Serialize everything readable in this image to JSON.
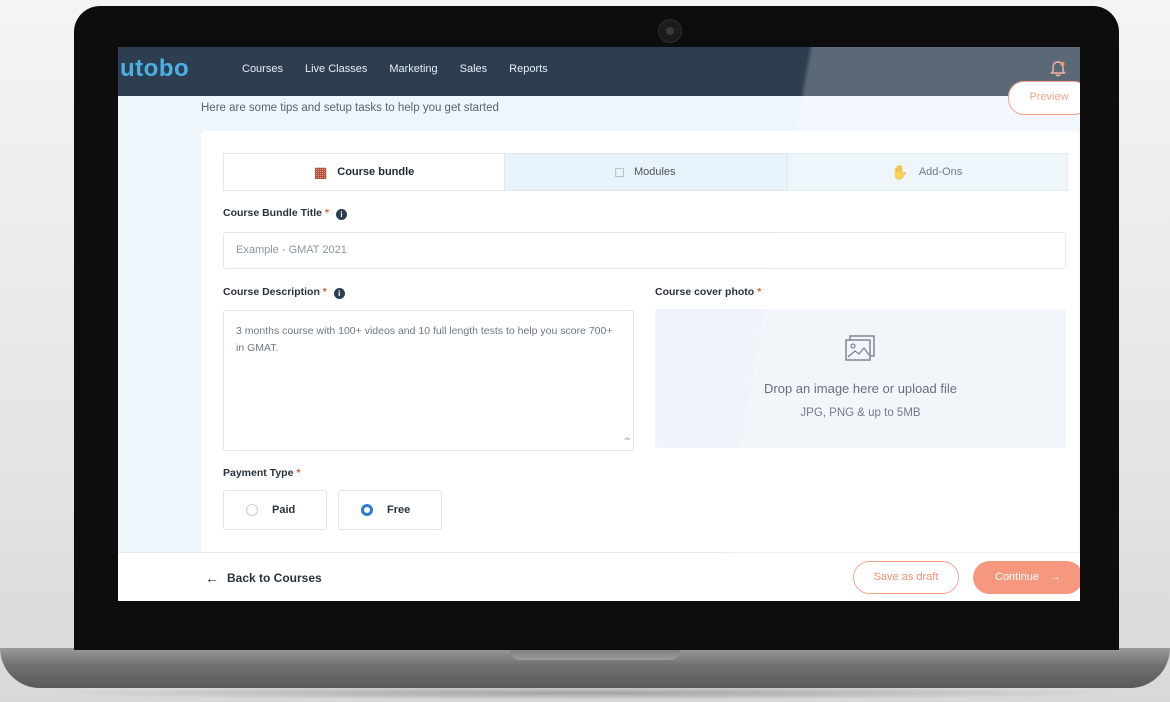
{
  "app": {
    "logo": "utobo",
    "nav": [
      "Courses",
      "Live Classes",
      "Marketing",
      "Sales",
      "Reports"
    ],
    "preview_label": "Preview"
  },
  "tips_text": "Here are some tips and setup tasks to help you get started",
  "tabs": [
    {
      "label": "Course bundle",
      "icon": "bundle-icon",
      "active": true
    },
    {
      "label": "Modules",
      "icon": "window-icon",
      "active": false
    },
    {
      "label": "Add-Ons",
      "icon": "hand-icon",
      "active": false
    }
  ],
  "form": {
    "title_label": "Course Bundle Title",
    "title_placeholder": "Example - GMAT 2021",
    "description_label": "Course Description",
    "description_value": "3 months course with 100+ videos and 10 full length tests to help you score 700+ in GMAT.",
    "cover_label": "Course cover photo",
    "drop_title": "Drop an image here or upload file",
    "drop_sub": "JPG, PNG & up to 5MB",
    "payment_label": "Payment Type",
    "payment_options": [
      {
        "label": "Paid",
        "selected": false
      },
      {
        "label": "Free",
        "selected": true
      }
    ],
    "required_mark": "*"
  },
  "footer": {
    "back_label": "Back to Courses",
    "draft_label": "Save as draft",
    "continue_label": "Continue"
  },
  "colors": {
    "navbar": "#2d3e50",
    "accent": "#f47b5a",
    "logo": "#4ab0e6",
    "radio_selected": "#2b7ad8"
  }
}
